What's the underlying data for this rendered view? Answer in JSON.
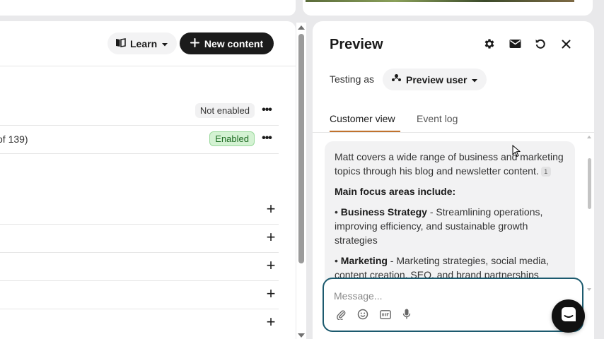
{
  "toolbar": {
    "learn_label": "Learn",
    "new_content_label": "New content"
  },
  "content_rows": [
    {
      "text": "",
      "status": "Not enabled"
    },
    {
      "text": "of 139)",
      "status": "Enabled"
    }
  ],
  "preview": {
    "title": "Preview",
    "testing_as_label": "Testing as",
    "preview_user_label": "Preview user",
    "tabs": [
      {
        "label": "Customer view",
        "active": true
      },
      {
        "label": "Event log",
        "active": false
      }
    ],
    "message": {
      "intro": "Matt covers a wide range of business and marketing topics through his blog and newsletter content.",
      "citation": "1",
      "focus_heading": "Main focus areas include:",
      "bullets": [
        {
          "title": "Business Strategy",
          "text": " - Streamlining operations, improving efficiency, and sustainable growth strategies"
        },
        {
          "title": "Marketing",
          "text": " - Marketing strategies, social media, content creation, SEO, and brand partnerships"
        }
      ]
    },
    "composer": {
      "placeholder": "Message..."
    }
  },
  "colors": {
    "accent_underline": "#c0722e",
    "composer_border": "#1c5a6e",
    "enabled_badge": "#d4f2d3",
    "dark_button": "#1b1b1b"
  }
}
